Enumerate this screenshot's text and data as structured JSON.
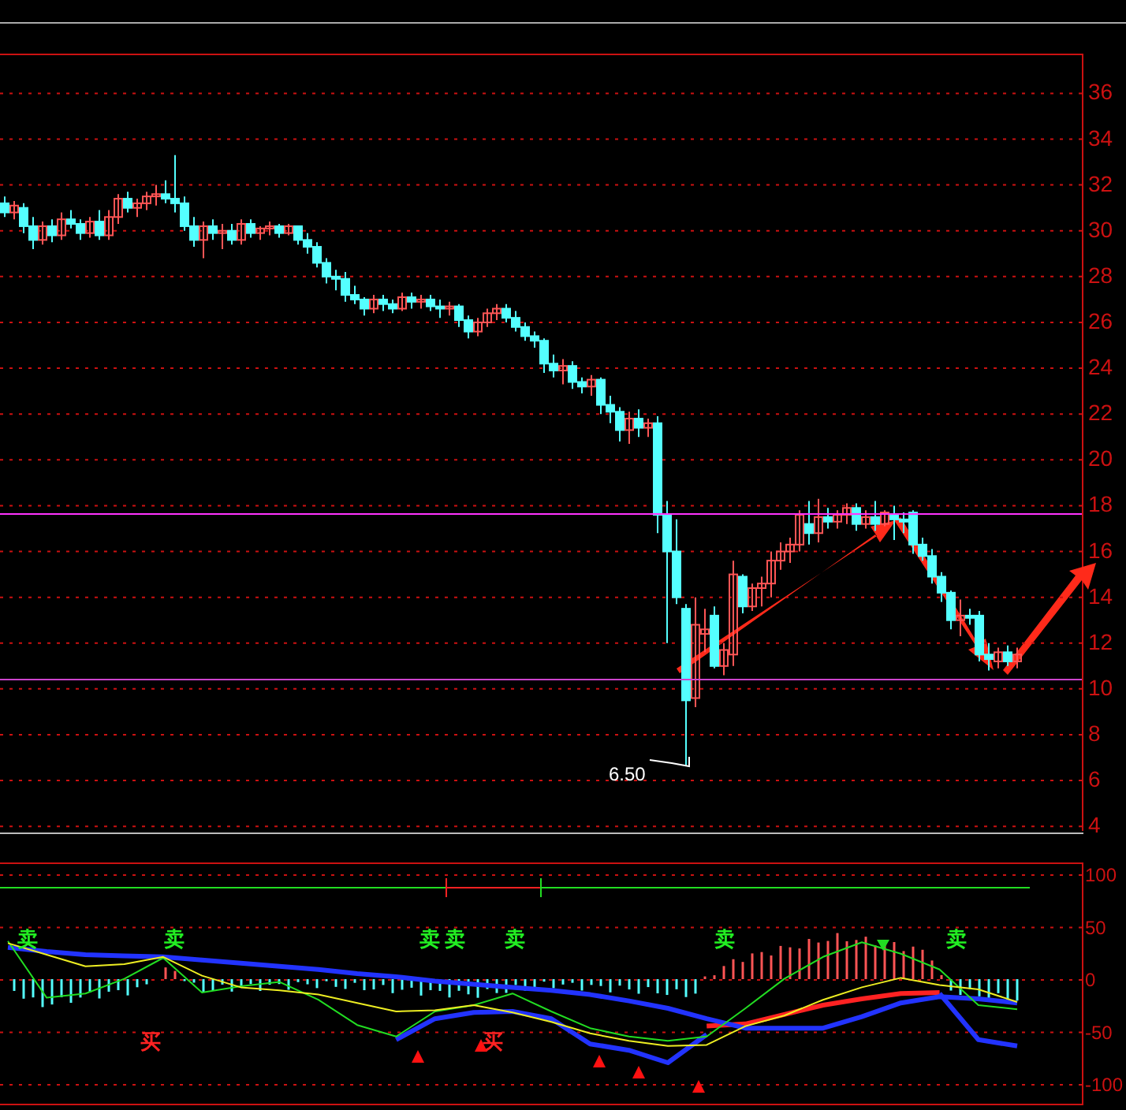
{
  "price_panel": {
    "chart_data": {
      "type": "candlestick",
      "grid": true,
      "ylim": [
        3.8,
        37.7
      ],
      "yticks": [
        36,
        34,
        32,
        30,
        28,
        26,
        24,
        22,
        20,
        18,
        16,
        14,
        12,
        10,
        8,
        6,
        4
      ],
      "categories": [
        null,
        null,
        null,
        null,
        null,
        null,
        null,
        null,
        null,
        null,
        null,
        null,
        null,
        null,
        null,
        null,
        null,
        null,
        null,
        null,
        null,
        null,
        null,
        null,
        null,
        null,
        null,
        null,
        null,
        null,
        null,
        null,
        null,
        null,
        null,
        null,
        null,
        null,
        null,
        null,
        null,
        null,
        null,
        null,
        null,
        null,
        null,
        null,
        null,
        null,
        null,
        null,
        null,
        null,
        null,
        null,
        null,
        null,
        null,
        null,
        null,
        null,
        null,
        null,
        null,
        null,
        null,
        null,
        null,
        null,
        null,
        null,
        null,
        null,
        null,
        null,
        null,
        null,
        null,
        null,
        null,
        null,
        null,
        null,
        null,
        null,
        null,
        null,
        null,
        null,
        null,
        null,
        null,
        null,
        null,
        null,
        null,
        null,
        null,
        null,
        null,
        null,
        null,
        null,
        null,
        null,
        null,
        null
      ],
      "ohlc": [
        [
          31.2,
          31.5,
          30.6,
          30.8
        ],
        [
          30.8,
          31.3,
          30.5,
          31.1
        ],
        [
          31.0,
          31.2,
          29.9,
          30.2
        ],
        [
          30.2,
          30.6,
          29.2,
          29.6
        ],
        [
          29.6,
          30.4,
          29.4,
          30.2
        ],
        [
          30.2,
          30.5,
          29.5,
          29.8
        ],
        [
          29.8,
          30.8,
          29.6,
          30.5
        ],
        [
          30.5,
          30.9,
          30.1,
          30.3
        ],
        [
          30.3,
          30.5,
          29.6,
          29.9
        ],
        [
          29.9,
          30.6,
          29.7,
          30.4
        ],
        [
          30.4,
          30.9,
          29.6,
          29.8
        ],
        [
          29.8,
          30.9,
          29.6,
          30.6
        ],
        [
          30.6,
          31.6,
          30.3,
          31.4
        ],
        [
          31.4,
          31.7,
          30.8,
          31.0
        ],
        [
          31.0,
          31.4,
          30.6,
          31.2
        ],
        [
          31.2,
          31.7,
          30.9,
          31.5
        ],
        [
          31.5,
          32.0,
          31.1,
          31.6
        ],
        [
          31.6,
          32.2,
          31.2,
          31.4
        ],
        [
          31.4,
          33.3,
          30.8,
          31.2
        ],
        [
          31.2,
          31.5,
          30.0,
          30.2
        ],
        [
          30.2,
          30.6,
          29.3,
          29.6
        ],
        [
          29.6,
          30.4,
          28.8,
          30.2
        ],
        [
          30.2,
          30.5,
          29.6,
          29.9
        ],
        [
          29.9,
          30.3,
          29.2,
          30.0
        ],
        [
          30.0,
          30.3,
          29.4,
          29.6
        ],
        [
          29.6,
          30.5,
          29.4,
          30.3
        ],
        [
          30.3,
          30.5,
          29.7,
          29.9
        ],
        [
          29.9,
          30.2,
          29.6,
          30.1
        ],
        [
          30.1,
          30.4,
          29.8,
          30.2
        ],
        [
          30.2,
          30.3,
          29.7,
          29.9
        ],
        [
          29.9,
          30.3,
          29.8,
          30.2
        ],
        [
          30.2,
          30.2,
          29.4,
          29.6
        ],
        [
          29.6,
          29.9,
          29.0,
          29.3
        ],
        [
          29.3,
          29.5,
          28.4,
          28.6
        ],
        [
          28.6,
          28.8,
          27.7,
          28.0
        ],
        [
          28.0,
          28.3,
          27.4,
          27.9
        ],
        [
          27.9,
          28.2,
          26.9,
          27.2
        ],
        [
          27.2,
          27.6,
          26.8,
          27.0
        ],
        [
          27.0,
          27.1,
          26.3,
          26.6
        ],
        [
          26.6,
          27.2,
          26.4,
          27.0
        ],
        [
          27.0,
          27.2,
          26.5,
          26.8
        ],
        [
          26.8,
          27.0,
          26.4,
          26.6
        ],
        [
          26.6,
          27.3,
          26.5,
          27.1
        ],
        [
          27.1,
          27.3,
          26.6,
          26.9
        ],
        [
          26.9,
          27.2,
          26.6,
          27.0
        ],
        [
          27.0,
          27.2,
          26.5,
          26.7
        ],
        [
          26.7,
          27.0,
          26.2,
          26.6
        ],
        [
          26.6,
          26.9,
          26.3,
          26.7
        ],
        [
          26.7,
          26.8,
          25.8,
          26.1
        ],
        [
          26.1,
          26.3,
          25.3,
          25.6
        ],
        [
          25.6,
          26.2,
          25.4,
          26.0
        ],
        [
          26.0,
          26.6,
          25.8,
          26.4
        ],
        [
          26.4,
          26.8,
          26.1,
          26.6
        ],
        [
          26.6,
          26.8,
          26.0,
          26.2
        ],
        [
          26.2,
          26.5,
          25.6,
          25.8
        ],
        [
          25.8,
          26.0,
          25.2,
          25.4
        ],
        [
          25.4,
          25.6,
          24.9,
          25.2
        ],
        [
          25.2,
          25.3,
          23.8,
          24.2
        ],
        [
          24.2,
          24.6,
          23.6,
          23.9
        ],
        [
          23.9,
          24.4,
          23.3,
          24.1
        ],
        [
          24.1,
          24.3,
          23.1,
          23.4
        ],
        [
          23.4,
          23.6,
          22.9,
          23.2
        ],
        [
          23.2,
          23.7,
          22.8,
          23.5
        ],
        [
          23.5,
          23.6,
          22.0,
          22.4
        ],
        [
          22.4,
          22.8,
          21.6,
          22.1
        ],
        [
          22.1,
          22.3,
          20.8,
          21.3
        ],
        [
          21.3,
          22.1,
          20.7,
          21.8
        ],
        [
          21.8,
          22.2,
          21.0,
          21.4
        ],
        [
          21.4,
          21.8,
          21.0,
          21.6
        ],
        [
          21.6,
          21.9,
          16.8,
          17.6
        ],
        [
          17.6,
          18.2,
          12.0,
          16.0
        ],
        [
          16.0,
          17.4,
          13.7,
          14.0
        ],
        [
          13.5,
          13.7,
          6.65,
          9.5
        ],
        [
          9.6,
          14.0,
          9.2,
          12.8
        ],
        [
          12.4,
          13.5,
          11.6,
          12.6
        ],
        [
          13.2,
          13.6,
          10.9,
          11.0
        ],
        [
          11.0,
          12.0,
          10.6,
          11.7
        ],
        [
          11.5,
          15.6,
          11.0,
          15.0
        ],
        [
          14.9,
          15.0,
          13.3,
          13.6
        ],
        [
          13.6,
          14.6,
          13.4,
          14.4
        ],
        [
          14.4,
          14.9,
          13.6,
          14.6
        ],
        [
          14.6,
          16.0,
          14.0,
          15.6
        ],
        [
          15.6,
          16.4,
          15.2,
          16.0
        ],
        [
          16.0,
          16.6,
          15.5,
          16.3
        ],
        [
          16.3,
          17.8,
          16.0,
          17.6
        ],
        [
          17.2,
          18.2,
          16.3,
          16.8
        ],
        [
          16.8,
          18.3,
          16.4,
          17.5
        ],
        [
          17.5,
          17.9,
          17.0,
          17.3
        ],
        [
          17.3,
          17.8,
          17.0,
          17.6
        ],
        [
          17.6,
          18.1,
          17.2,
          17.9
        ],
        [
          17.9,
          18.1,
          16.9,
          17.2
        ],
        [
          17.2,
          17.8,
          17.0,
          17.5
        ],
        [
          17.5,
          18.2,
          16.9,
          17.2
        ],
        [
          17.2,
          17.8,
          17.1,
          17.7
        ],
        [
          17.6,
          18.0,
          16.5,
          17.4
        ],
        [
          17.4,
          17.7,
          16.8,
          17.3
        ],
        [
          17.7,
          17.8,
          15.9,
          16.3
        ],
        [
          16.3,
          16.6,
          15.6,
          15.8
        ],
        [
          15.8,
          16.1,
          14.6,
          14.9
        ],
        [
          14.9,
          15.1,
          13.8,
          14.2
        ],
        [
          14.2,
          14.3,
          12.6,
          13.0
        ],
        [
          13.0,
          13.9,
          12.3,
          13.2
        ],
        [
          13.2,
          13.5,
          12.8,
          13.1
        ],
        [
          13.2,
          13.4,
          11.2,
          11.5
        ],
        [
          11.5,
          12.0,
          10.8,
          11.3
        ],
        [
          11.2,
          11.8,
          10.9,
          11.6
        ],
        [
          11.6,
          11.9,
          11.0,
          11.2
        ],
        [
          11.2,
          11.8,
          10.9,
          11.5
        ]
      ]
    },
    "low_label": "6.50"
  },
  "indicator_panel": {
    "sell_marks": [
      "卖",
      "卖",
      "卖",
      "卖",
      "卖",
      "卖",
      "卖"
    ],
    "buy_marks": [
      "买",
      "买"
    ],
    "chart_data": {
      "type": "line",
      "grid": true,
      "categories": [
        null,
        null,
        null,
        null,
        null,
        null,
        null,
        null,
        null,
        null,
        null,
        null,
        null,
        null,
        null,
        null,
        null,
        null,
        null,
        null,
        null,
        null,
        null,
        null,
        null,
        null,
        null
      ],
      "ylim": [
        -100,
        100
      ],
      "yticks": [
        {
          "value": 100,
          "label": "100"
        },
        {
          "value": 50,
          "label": "50"
        },
        {
          "value": 0,
          "label": "0"
        },
        {
          "value": -50,
          "label": "-50"
        },
        {
          "value": -100,
          "label": "-100"
        }
      ],
      "series": [
        {
          "color": "#eeee22",
          "values": [
            35,
            24,
            13,
            15,
            22,
            4,
            -7,
            -10,
            -14,
            -22,
            -30,
            -29,
            -24,
            -31,
            -40,
            -51,
            -58,
            -63,
            -62,
            -44,
            -34,
            -19,
            -7,
            2,
            -5,
            -9,
            -21
          ]
        },
        {
          "color": "#22dd22",
          "values": [
            37,
            -17,
            -13,
            1,
            21,
            -12,
            -6,
            -2,
            -19,
            -43,
            -54,
            -30,
            -24,
            -13,
            -30,
            -46,
            -54,
            -58,
            -54,
            -27,
            1,
            22,
            36,
            25,
            10,
            -24,
            -28
          ]
        },
        {
          "color": "#2233ff",
          "values": [
            31,
            27,
            24,
            23,
            22,
            19,
            16,
            13,
            10,
            6,
            3,
            -1,
            -4,
            -7,
            -10,
            -14,
            -20,
            -27,
            -37,
            -46,
            -46,
            -46,
            -35,
            -22,
            -16,
            -18,
            -22
          ]
        },
        {
          "color": "#2233ff",
          "values": [
            null,
            null,
            null,
            null,
            null,
            null,
            null,
            null,
            null,
            null,
            -57,
            -37,
            -31,
            -30,
            -37,
            -61,
            -67,
            -79,
            -52,
            null,
            null,
            null,
            null,
            null,
            -13,
            -57,
            -63
          ]
        },
        {
          "color": "#ff2222",
          "values": [
            null,
            null,
            null,
            null,
            null,
            null,
            null,
            null,
            null,
            null,
            null,
            null,
            null,
            null,
            null,
            null,
            null,
            null,
            -44,
            -42,
            -33,
            -24,
            -18,
            -13,
            -12,
            null,
            null
          ]
        }
      ]
    }
  }
}
